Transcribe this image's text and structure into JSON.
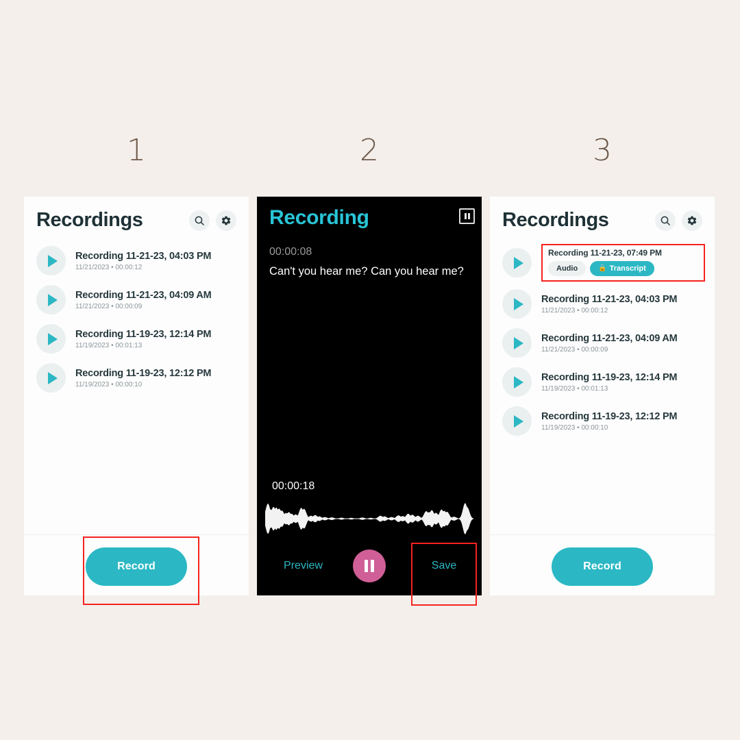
{
  "steps": [
    {
      "label": "1"
    },
    {
      "label": "2"
    },
    {
      "label": "3"
    }
  ],
  "panel1": {
    "title": "Recordings",
    "search_icon": "search-icon",
    "settings_icon": "gear-icon",
    "record_label": "Record",
    "items": [
      {
        "name": "Recording 11-21-23, 04:03 PM",
        "meta": "11/21/2023 • 00:00:12"
      },
      {
        "name": "Recording 11-21-23, 04:09 AM",
        "meta": "11/21/2023 • 00:00:09"
      },
      {
        "name": "Recording 11-19-23, 12:14 PM",
        "meta": "11/19/2023 • 00:01:13"
      },
      {
        "name": "Recording 11-19-23, 12:12 PM",
        "meta": "11/19/2023 • 00:00:10"
      }
    ]
  },
  "panel2": {
    "title": "Recording",
    "pause_icon": "pause-icon",
    "live_time": "00:00:08",
    "live_text": "Can't you hear me? Can you hear me?",
    "total_time": "00:00:18",
    "preview_label": "Preview",
    "save_label": "Save",
    "pause_button_icon": "pause-icon"
  },
  "panel3": {
    "title": "Recordings",
    "search_icon": "search-icon",
    "settings_icon": "gear-icon",
    "record_label": "Record",
    "new_item": {
      "name": "Recording 11-21-23, 07:49 PM",
      "audio_chip": "Audio",
      "transcript_chip": "Transcript",
      "transcript_lock_icon": "lock-icon"
    },
    "items": [
      {
        "name": "Recording 11-21-23, 04:03 PM",
        "meta": "11/21/2023 • 00:00:12"
      },
      {
        "name": "Recording 11-21-23, 04:09 AM",
        "meta": "11/21/2023 • 00:00:09"
      },
      {
        "name": "Recording 11-19-23, 12:14 PM",
        "meta": "11/19/2023 • 00:01:13"
      },
      {
        "name": "Recording 11-19-23, 12:12 PM",
        "meta": "11/19/2023 • 00:00:10"
      }
    ]
  },
  "colors": {
    "background": "#f4efeb",
    "accent_teal": "#2bb8c4",
    "recording_title_teal": "#28c4d6",
    "pause_pink": "#cf5f96",
    "annotation_red": "#f5231f",
    "step_number": "#6f5b4b",
    "text_dark": "#26383d",
    "text_muted": "#8b9499"
  }
}
